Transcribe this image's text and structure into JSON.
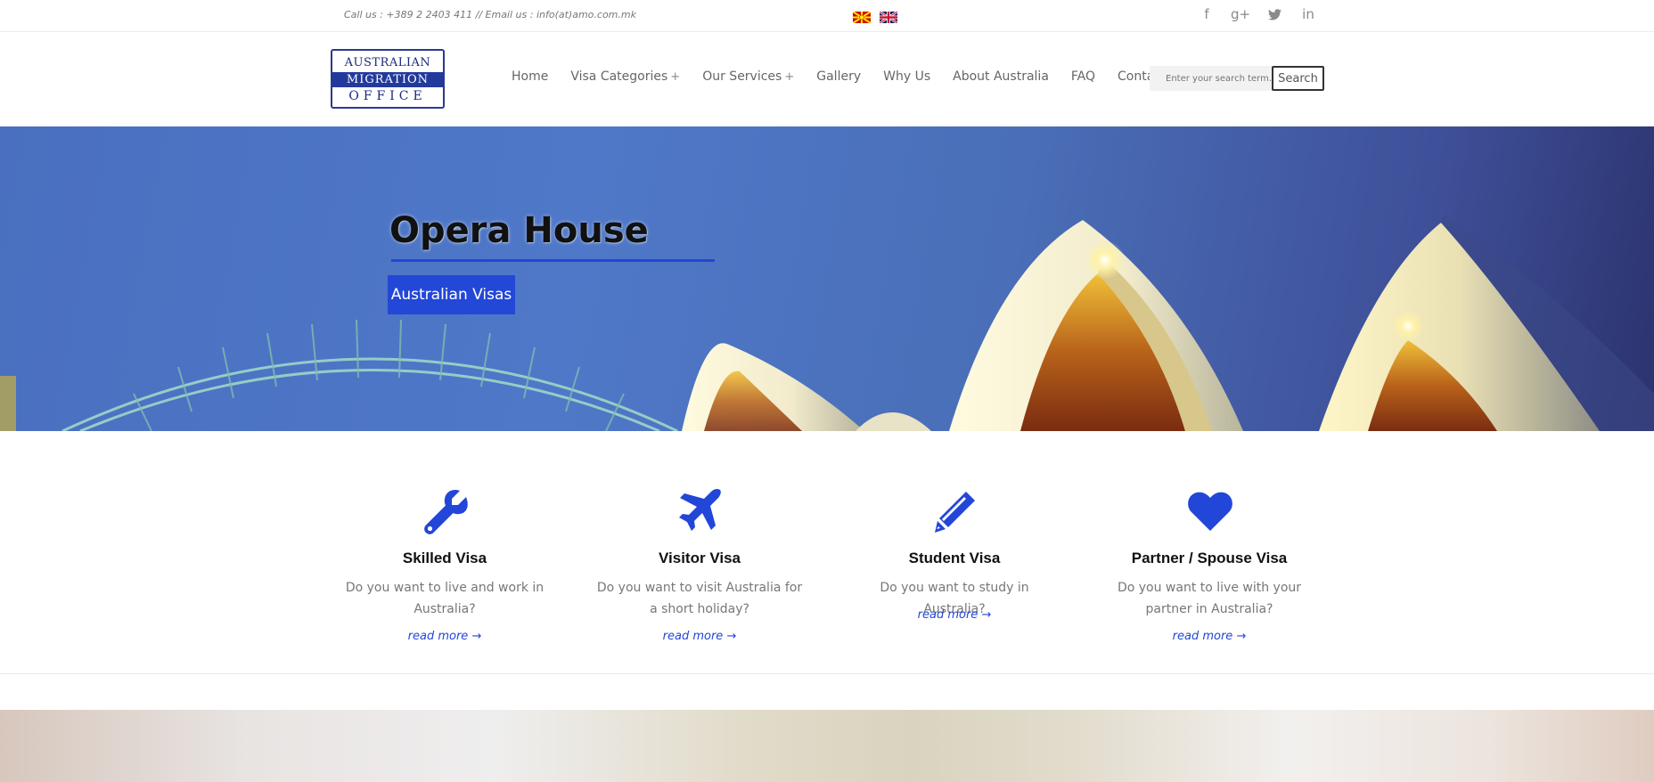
{
  "topbar": {
    "contact": "Call us : +389 2 2403 411 // Email us : info(at)amo.com.mk",
    "languages": [
      "Macedonian",
      "English"
    ],
    "socials": [
      {
        "name": "facebook",
        "glyph": "f"
      },
      {
        "name": "google-plus",
        "glyph": "g+"
      },
      {
        "name": "twitter",
        "glyph": "t"
      },
      {
        "name": "linkedin",
        "glyph": "in"
      }
    ]
  },
  "header": {
    "logo": {
      "line1": "AUSTRALIAN",
      "line2": "MIGRATION",
      "line3": "OFFICE"
    },
    "nav": [
      {
        "label": "Home",
        "plus": ""
      },
      {
        "label": "Visa Categories",
        "plus": "+"
      },
      {
        "label": "Our Services",
        "plus": "+"
      },
      {
        "label": "Gallery",
        "plus": ""
      },
      {
        "label": "Why Us",
        "plus": ""
      },
      {
        "label": "About Australia",
        "plus": ""
      },
      {
        "label": "FAQ",
        "plus": ""
      },
      {
        "label": "Contact Us",
        "plus": ""
      }
    ],
    "search": {
      "placeholder": "Enter your search term...",
      "button": "Search"
    }
  },
  "hero": {
    "title": "Opera House",
    "button": "Australian Visas",
    "colors": {
      "accent": "#2347d6"
    }
  },
  "features": [
    {
      "icon": "wrench-icon",
      "title": "Skilled Visa",
      "text": "Do you want to live and work in Australia?",
      "link": "read more →"
    },
    {
      "icon": "plane-icon",
      "title": "Visitor Visa",
      "text": "Do you want to visit Australia for a short holiday?",
      "link": "read more →"
    },
    {
      "icon": "pencil-icon",
      "title": "Student Visa",
      "text": "Do you want to study in Australia?",
      "link": "read more →"
    },
    {
      "icon": "heart-icon",
      "title": "Partner / Spouse Visa",
      "text": "Do you want to live with your partner in Australia?",
      "link": "read more →"
    }
  ]
}
